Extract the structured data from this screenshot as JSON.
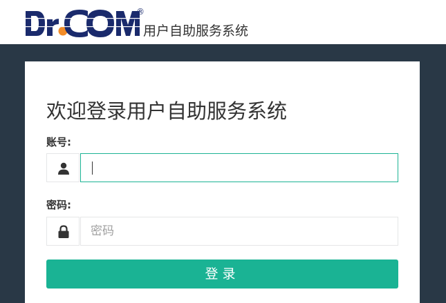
{
  "header": {
    "logo_text": "Dr.COM",
    "logo_mark": "®",
    "system_name": "用户自助服务系统"
  },
  "login": {
    "welcome_title": "欢迎登录用户自助服务系统",
    "account_label": "账号:",
    "account_value": "",
    "password_label": "密码:",
    "password_placeholder": "密码",
    "submit_label": "登录"
  },
  "colors": {
    "accent": "#1ab394",
    "dark_bg": "#293846",
    "logo_blue": "#1a2a6c",
    "logo_orange": "#f28c28"
  }
}
